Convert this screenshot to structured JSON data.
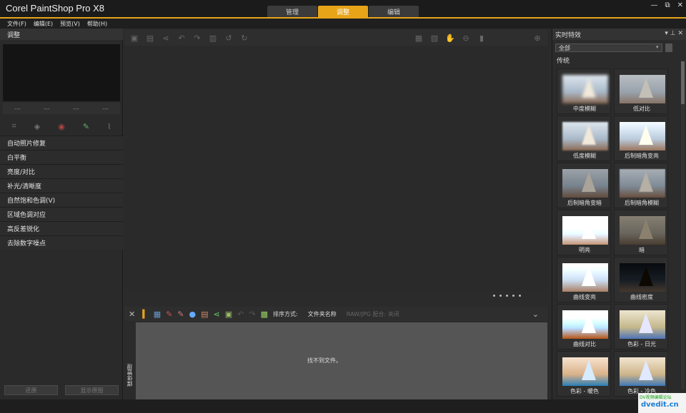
{
  "app": {
    "title": "Corel PaintShop Pro X8"
  },
  "tabs": [
    {
      "label": "管理"
    },
    {
      "label": "调整"
    },
    {
      "label": "编辑"
    }
  ],
  "window_controls": {
    "minimize": "—",
    "restore": "⧉",
    "close": "✕"
  },
  "menu": [
    {
      "label": "文件(F)"
    },
    {
      "label": "编辑(E)"
    },
    {
      "label": "预览(V)"
    },
    {
      "label": "帮助(H)"
    }
  ],
  "left_panel": {
    "title": "调整",
    "dash_values": [
      "---",
      "---",
      "---",
      "---"
    ],
    "tools": [
      "crop-icon",
      "straighten-icon",
      "red-eye-icon",
      "clone-icon",
      "brush-icon"
    ],
    "items": [
      {
        "label": "自动照片修复"
      },
      {
        "label": "白平衡"
      },
      {
        "label": "亮度/对比"
      },
      {
        "label": "补光/清晰度"
      },
      {
        "label": "自然饱和色调(V)"
      },
      {
        "label": "区域色调对应"
      },
      {
        "label": "高反差锐化"
      },
      {
        "label": "去除数字噪点"
      }
    ],
    "buttons": {
      "apply": "还原",
      "display": "显示原图"
    }
  },
  "center_toolbar": {
    "icons": [
      "save-icon",
      "save-as-icon",
      "share-icon",
      "undo-icon",
      "redo-icon",
      "delete-icon",
      "rotate-left-icon",
      "rotate-right-icon",
      "fit-window-icon",
      "actual-size-icon",
      "pan-hand-icon",
      "zoom-out-icon",
      "zoom-slider-icon",
      "zoom-in-icon"
    ]
  },
  "organizer": {
    "sort_label": "排序方式:",
    "sort_value": "文件夹名称",
    "filter_label": "RAW/JPG 配合: 关闭",
    "side_label": "媒体管理",
    "empty_message": "找不到文件。"
  },
  "right_panel": {
    "title": "实时特效",
    "filter_select": "全部",
    "category": "传统",
    "effects": [
      {
        "label": "中度模糊"
      },
      {
        "label": "低对比"
      },
      {
        "label": "低度模糊"
      },
      {
        "label": "后制暗角变亮"
      },
      {
        "label": "后制暗角变暗"
      },
      {
        "label": "后制暗角模糊"
      },
      {
        "label": "明亮"
      },
      {
        "label": "暗"
      },
      {
        "label": "曲线变亮"
      },
      {
        "label": "曲线密度"
      },
      {
        "label": "曲线对比"
      },
      {
        "label": "色彩 - 日光"
      },
      {
        "label": "色彩 - 暖色"
      },
      {
        "label": "色彩 - 冷色"
      }
    ]
  },
  "watermark": {
    "line1": "DV视频编辑论坛",
    "line2": "dvedit.cn"
  },
  "colors": {
    "accent": "#e7a419",
    "background": "#2b2b2b"
  }
}
